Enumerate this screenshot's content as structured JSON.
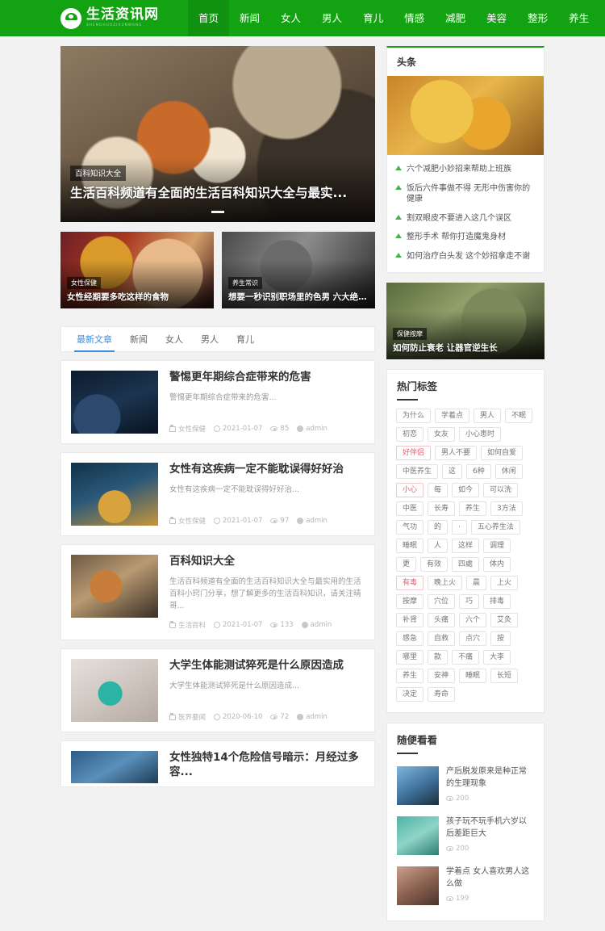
{
  "header": {
    "logo_title": "生活资讯网",
    "logo_sub": "SHENGHUOZIXUNWANG",
    "logo_icon": "cloud-logo-icon",
    "search_icon": "search-icon",
    "nav": [
      {
        "label": "首页",
        "active": true
      },
      {
        "label": "新闻",
        "active": false
      },
      {
        "label": "女人",
        "active": false
      },
      {
        "label": "男人",
        "active": false
      },
      {
        "label": "育儿",
        "active": false
      },
      {
        "label": "情感",
        "active": false
      },
      {
        "label": "减肥",
        "active": false
      },
      {
        "label": "美容",
        "active": false
      },
      {
        "label": "整形",
        "active": false
      },
      {
        "label": "养生",
        "active": false
      }
    ]
  },
  "hero": {
    "badge": "百科知识大全",
    "title": "生活百科频道有全面的生活百科知识大全与最实...",
    "indicator": "slide-1"
  },
  "cards": [
    {
      "badge": "女性保健",
      "title": "女性经期要多吃这样的食物"
    },
    {
      "badge": "养生常识",
      "title": "想要一秒识别职场里的色男 六大绝招看过"
    },
    {
      "badge": "保健按摩",
      "title": "如何防止衰老 让器官逆生长"
    }
  ],
  "headlines": {
    "title": "头条",
    "items": [
      "六个减肥小妙招来帮助上班族",
      "饭后六件事做不得 无形中伤害你的健康",
      "割双眼皮不要进入这几个误区",
      "整形手术 帮你打造魔鬼身材",
      "如何治疗白头发 这个妙招拿走不谢"
    ]
  },
  "tabs": [
    {
      "label": "最新文章",
      "active": true
    },
    {
      "label": "新闻",
      "active": false
    },
    {
      "label": "女人",
      "active": false
    },
    {
      "label": "男人",
      "active": false
    },
    {
      "label": "育儿",
      "active": false
    }
  ],
  "articles": [
    {
      "title": "警惕更年期综合症带来的危害",
      "desc": "警惕更年期综合症带来的危害...",
      "category": "女性保健",
      "date": "2021-01-07",
      "views": "85",
      "author": "admin"
    },
    {
      "title": "女性有这疾病一定不能耽误得好好治",
      "desc": "女性有这疾病一定不能耽误得好好治...",
      "category": "女性保健",
      "date": "2021-01-07",
      "views": "97",
      "author": "admin"
    },
    {
      "title": "百科知识大全",
      "desc": "生活百科频道有全面的生活百科知识大全与最实用的生活百科小窍门分享，想了解更多的生活百科知识，请关注晴哥...",
      "category": "生活百科",
      "date": "2021-01-07",
      "views": "133",
      "author": "admin"
    },
    {
      "title": "大学生体能测试猝死是什么原因造成",
      "desc": "大学生体能测试猝死是什么原因造成...",
      "category": "医界要闻",
      "date": "2020-06-10",
      "views": "72",
      "author": "admin"
    },
    {
      "title": "女性独特14个危险信号暗示：月经过多容...",
      "desc": "",
      "category": "",
      "date": "",
      "views": "",
      "author": ""
    }
  ],
  "tags_panel": {
    "title": "热门标签",
    "tags": [
      {
        "label": "为什么",
        "hot": false
      },
      {
        "label": "学着点",
        "hot": false
      },
      {
        "label": "男人",
        "hot": false
      },
      {
        "label": "不眠",
        "hot": false
      },
      {
        "label": "初恋",
        "hot": false
      },
      {
        "label": "女友",
        "hot": false
      },
      {
        "label": "小心患时",
        "hot": false
      },
      {
        "label": "好伴侣",
        "hot": true
      },
      {
        "label": "男人不要",
        "hot": false
      },
      {
        "label": "如何自爱",
        "hot": false
      },
      {
        "label": "中医养生",
        "hot": false
      },
      {
        "label": "这",
        "hot": false
      },
      {
        "label": "6种",
        "hot": false
      },
      {
        "label": "休闲",
        "hot": false
      },
      {
        "label": "小心",
        "hot": true
      },
      {
        "label": "每",
        "hot": false
      },
      {
        "label": "如今",
        "hot": false
      },
      {
        "label": "可以洗",
        "hot": false
      },
      {
        "label": "中医",
        "hot": false
      },
      {
        "label": "长寿",
        "hot": false
      },
      {
        "label": "养生",
        "hot": false
      },
      {
        "label": "3方法",
        "hot": false
      },
      {
        "label": "气功",
        "hot": false
      },
      {
        "label": "的",
        "hot": false
      },
      {
        "label": "·",
        "hot": false
      },
      {
        "label": "五心养生法",
        "hot": false
      },
      {
        "label": "睡眠",
        "hot": false
      },
      {
        "label": "人",
        "hot": false
      },
      {
        "label": "这样",
        "hot": false
      },
      {
        "label": "调理",
        "hot": false
      },
      {
        "label": "更",
        "hot": false
      },
      {
        "label": "有效",
        "hot": false
      },
      {
        "label": "四處",
        "hot": false
      },
      {
        "label": "体内",
        "hot": false
      },
      {
        "label": "有毒",
        "hot": true
      },
      {
        "label": "晚上火",
        "hot": false
      },
      {
        "label": "晨",
        "hot": false
      },
      {
        "label": "上火",
        "hot": false
      },
      {
        "label": "按摩",
        "hot": false
      },
      {
        "label": "穴位",
        "hot": false
      },
      {
        "label": "巧",
        "hot": false
      },
      {
        "label": "排毒",
        "hot": false
      },
      {
        "label": "补肾",
        "hot": false
      },
      {
        "label": "头痛",
        "hot": false
      },
      {
        "label": "六个",
        "hot": false
      },
      {
        "label": "艾灸",
        "hot": false
      },
      {
        "label": "感急",
        "hot": false
      },
      {
        "label": "自救",
        "hot": false
      },
      {
        "label": "点穴",
        "hot": false
      },
      {
        "label": "按",
        "hot": false
      },
      {
        "label": "哪里",
        "hot": false
      },
      {
        "label": "款",
        "hot": false
      },
      {
        "label": "不痛",
        "hot": false
      },
      {
        "label": "大李",
        "hot": false
      },
      {
        "label": "养生",
        "hot": false
      },
      {
        "label": "安神",
        "hot": false
      },
      {
        "label": "睡眠",
        "hot": false
      },
      {
        "label": "长短",
        "hot": false
      },
      {
        "label": "决定",
        "hot": false
      },
      {
        "label": "寿命",
        "hot": false
      }
    ]
  },
  "random_panel": {
    "title": "随便看看",
    "items": [
      {
        "title": "产后脱发原来是种正常的生理现象",
        "views": "200"
      },
      {
        "title": "孩子玩不玩手机六岁以后差距巨大",
        "views": "200"
      },
      {
        "title": "学着点 女人喜欢男人这么做",
        "views": "199"
      }
    ]
  }
}
